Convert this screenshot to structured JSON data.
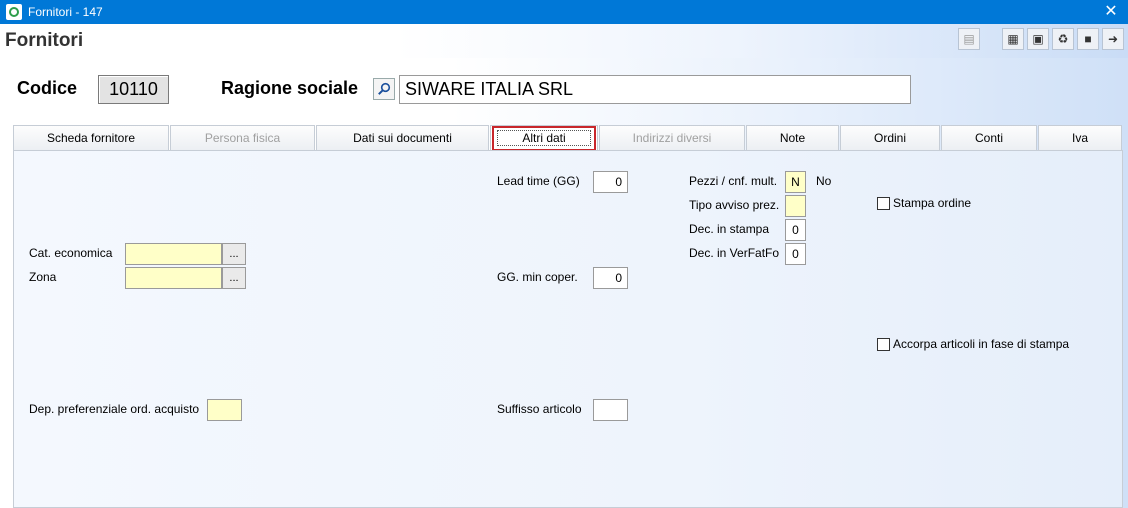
{
  "window": {
    "title": "Fornitori - 147",
    "close_icon": "close-icon"
  },
  "header": {
    "title": "Fornitori"
  },
  "form": {
    "codice_label": "Codice",
    "codice_value": "10110",
    "ragione_label": "Ragione sociale",
    "ragione_value": "SIWARE ITALIA SRL"
  },
  "tabs": [
    {
      "label": "Scheda fornitore",
      "enabled": true
    },
    {
      "label": "Persona fisica",
      "enabled": false
    },
    {
      "label": "Dati sui documenti",
      "enabled": true
    },
    {
      "label": "Altri dati",
      "enabled": true,
      "active": true
    },
    {
      "label": "Indirizzi diversi",
      "enabled": false
    },
    {
      "label": "Note",
      "enabled": true
    },
    {
      "label": "Ordini",
      "enabled": true
    },
    {
      "label": "Conti",
      "enabled": true
    },
    {
      "label": "Iva",
      "enabled": true
    }
  ],
  "fields": {
    "cat_economica_label": "Cat. economica",
    "cat_economica_value": "",
    "zona_label": "Zona",
    "zona_value": "",
    "ellipsis": "...",
    "dep_pref_label": "Dep. preferenziale ord. acquisto",
    "dep_pref_value": "",
    "lead_time_label": "Lead time (GG)",
    "lead_time_value": "0",
    "gg_min_label": "GG. min coper.",
    "gg_min_value": "0",
    "suffisso_label": "Suffisso articolo",
    "suffisso_value": "",
    "pezzi_label": "Pezzi / cnf. mult.",
    "pezzi_value": "N",
    "pezzi_desc": "No",
    "tipo_avviso_label": "Tipo avviso prez.",
    "tipo_avviso_value": "",
    "dec_stampa_label": "Dec. in stampa",
    "dec_stampa_value": "0",
    "dec_verfatfo_label": "Dec. in VerFatFo",
    "dec_verfatfo_value": "0",
    "stampa_ordine_label": "Stampa ordine",
    "stampa_ordine_checked": false,
    "accorpa_label": "Accorpa articoli in fase di stampa",
    "accorpa_checked": false
  }
}
